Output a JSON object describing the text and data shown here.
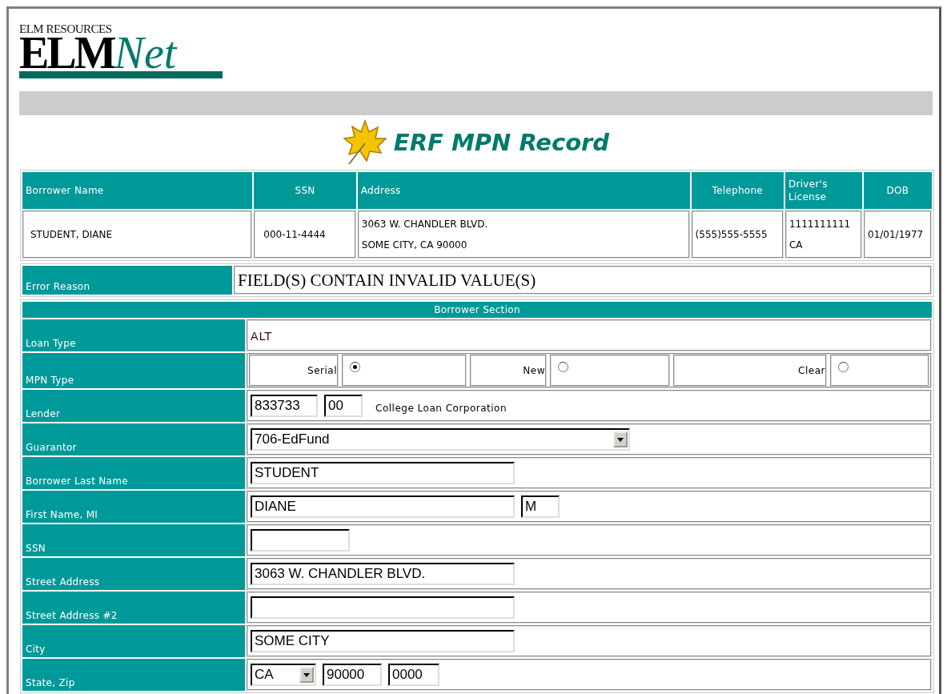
{
  "logo": {
    "top": "ELM RESOURCES",
    "main": "ELM",
    "accent": "Net"
  },
  "title": "ERF MPN Record",
  "summary": {
    "columns": [
      "Borrower Name",
      "SSN",
      "Address",
      "Telephone",
      "Driver's License",
      "DOB"
    ],
    "row": [
      [
        "STUDENT, DIANE"
      ],
      [
        "000-11-4444"
      ],
      [
        "3063 W. CHANDLER BLVD.",
        "SOME CITY, CA 90000"
      ],
      [
        "(555)555-5555"
      ],
      [
        "1111111111",
        "CA"
      ],
      [
        "01/01/1977"
      ]
    ]
  },
  "error": {
    "label": "Error Reason",
    "value": "FIELD(S) CONTAIN INVALID VALUE(S)"
  },
  "section": {
    "title": "Borrower Section",
    "rows": [
      {
        "label": "Loan Type",
        "kind": "static",
        "value": "ALT"
      },
      {
        "label": "MPN Type",
        "kind": "radios",
        "options": [
          {
            "label": "Serial",
            "selected": true
          },
          {
            "label": "New",
            "selected": false
          },
          {
            "label": "Clear",
            "selected": false
          }
        ]
      },
      {
        "label": "Lender",
        "kind": "inputs",
        "fields": [
          {
            "kind": "small",
            "value": "833733"
          },
          {
            "kind": "tiny",
            "value": "00"
          }
        ],
        "note": "College Loan Corporation"
      },
      {
        "label": "Guarantor",
        "kind": "inputs",
        "fields": [
          {
            "kind": "select",
            "value": "706-EdFund"
          }
        ]
      },
      {
        "label": "Borrower Last Name",
        "kind": "inputs",
        "fields": [
          {
            "kind": "wide",
            "value": "STUDENT"
          }
        ]
      },
      {
        "label": "First Name, MI",
        "kind": "inputs",
        "fields": [
          {
            "kind": "wide",
            "value": "DIANE"
          },
          {
            "kind": "tiny",
            "value": "M"
          }
        ]
      },
      {
        "label": "SSN",
        "kind": "inputs",
        "fields": [
          {
            "kind": "medium"
          }
        ]
      },
      {
        "label": "Street Address",
        "kind": "inputs",
        "fields": [
          {
            "kind": "wide",
            "value": "3063 W. CHANDLER BLVD."
          }
        ]
      },
      {
        "label": "Street Address #2",
        "kind": "inputs",
        "fields": [
          {
            "kind": "wide"
          }
        ]
      },
      {
        "label": "City",
        "kind": "inputs",
        "fields": [
          {
            "kind": "wide",
            "value": "SOME CITY"
          }
        ]
      },
      {
        "label": "State, Zip",
        "kind": "inputs",
        "fields": [
          {
            "kind": "short-select",
            "value": "CA"
          },
          {
            "kind": "zip",
            "value": "90000"
          },
          {
            "kind": "zip4",
            "value": "0000"
          }
        ]
      }
    ]
  }
}
